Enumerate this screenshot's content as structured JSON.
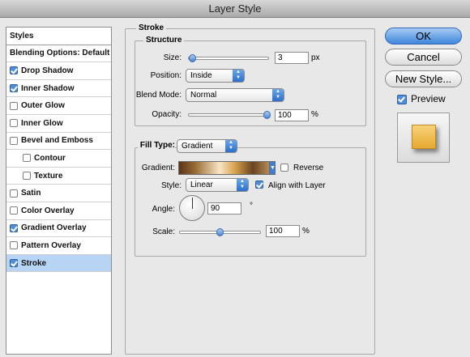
{
  "window": {
    "title": "Layer Style"
  },
  "styles_panel": {
    "header": "Styles",
    "items": [
      {
        "label": "Blending Options: Default",
        "checkbox": false,
        "checked": false,
        "indent": false,
        "selected": false
      },
      {
        "label": "Drop Shadow",
        "checkbox": true,
        "checked": true,
        "indent": false,
        "selected": false
      },
      {
        "label": "Inner Shadow",
        "checkbox": true,
        "checked": true,
        "indent": false,
        "selected": false
      },
      {
        "label": "Outer Glow",
        "checkbox": true,
        "checked": false,
        "indent": false,
        "selected": false
      },
      {
        "label": "Inner Glow",
        "checkbox": true,
        "checked": false,
        "indent": false,
        "selected": false
      },
      {
        "label": "Bevel and Emboss",
        "checkbox": true,
        "checked": false,
        "indent": false,
        "selected": false
      },
      {
        "label": "Contour",
        "checkbox": true,
        "checked": false,
        "indent": true,
        "selected": false
      },
      {
        "label": "Texture",
        "checkbox": true,
        "checked": false,
        "indent": true,
        "selected": false
      },
      {
        "label": "Satin",
        "checkbox": true,
        "checked": false,
        "indent": false,
        "selected": false
      },
      {
        "label": "Color Overlay",
        "checkbox": true,
        "checked": false,
        "indent": false,
        "selected": false
      },
      {
        "label": "Gradient Overlay",
        "checkbox": true,
        "checked": true,
        "indent": false,
        "selected": false
      },
      {
        "label": "Pattern Overlay",
        "checkbox": true,
        "checked": false,
        "indent": false,
        "selected": false
      },
      {
        "label": "Stroke",
        "checkbox": true,
        "checked": true,
        "indent": false,
        "selected": true
      }
    ]
  },
  "stroke": {
    "section_title": "Stroke",
    "structure_title": "Structure",
    "size_label": "Size:",
    "size_value": "3",
    "size_unit": "px",
    "size_level": 0.01,
    "position_label": "Position:",
    "position_value": "Inside",
    "blend_mode_label": "Blend Mode:",
    "blend_mode_value": "Normal",
    "opacity_label": "Opacity:",
    "opacity_value": "100",
    "opacity_unit": "%",
    "opacity_level": 1.0,
    "fill_type_label": "Fill Type:",
    "fill_type_value": "Gradient",
    "gradient_label": "Gradient:",
    "reverse_label": "Reverse",
    "reverse_checked": false,
    "style_label": "Style:",
    "style_value": "Linear",
    "align_label": "Align with Layer",
    "align_checked": true,
    "angle_label": "Angle:",
    "angle_value": "90",
    "angle_unit": "°",
    "scale_label": "Scale:",
    "scale_value": "100",
    "scale_unit": "%",
    "scale_level": 0.5
  },
  "buttons": {
    "ok": "OK",
    "cancel": "Cancel",
    "new_style": "New Style...",
    "preview_label": "Preview",
    "preview_checked": true
  },
  "colors": {
    "selected_row": "#b8d4f4",
    "accent_blue": "#3f86dc",
    "preview_fill": "#f0be4f"
  }
}
